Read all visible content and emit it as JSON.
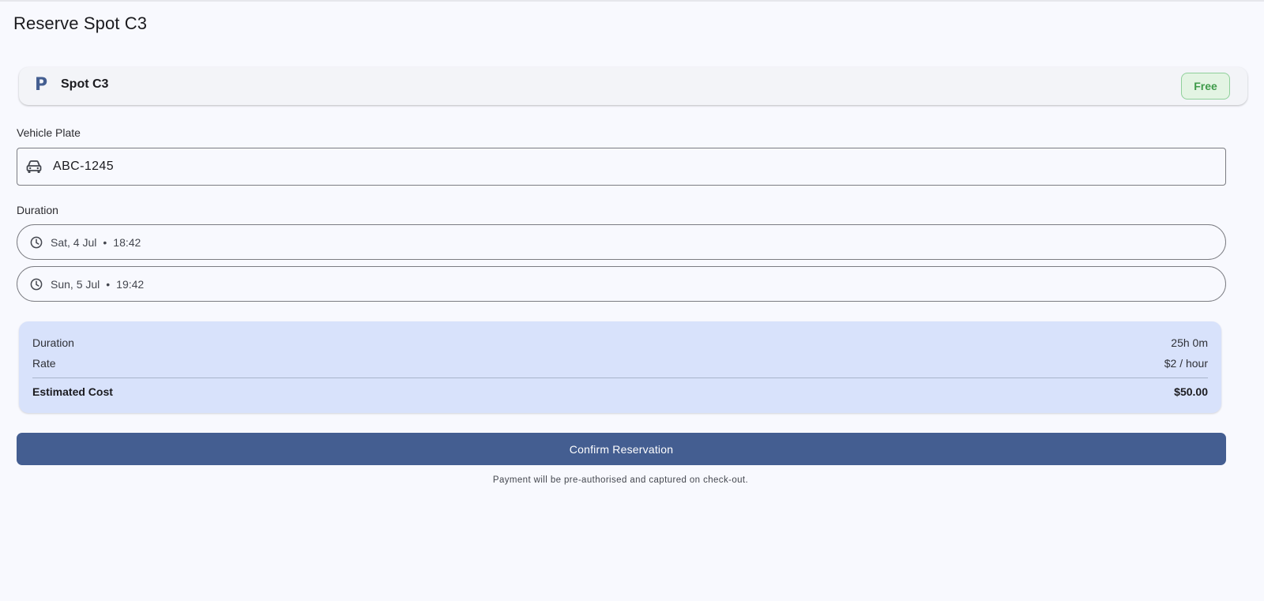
{
  "app_bar": {
    "title": "Reserve Spot C3"
  },
  "spot": {
    "icon_glyph": "P",
    "icon": "parking-icon",
    "name": "Spot C3",
    "status": "Free",
    "status_color": "#3f9b4a"
  },
  "vehicle": {
    "label": "Vehicle Plate",
    "icon": "car-icon",
    "value": "ABC-1245"
  },
  "duration": {
    "label": "Duration",
    "start": {
      "icon": "clock-icon",
      "date": "Sat, 4 Jul",
      "separator": "•",
      "time": "18:42"
    },
    "end": {
      "icon": "clock-icon",
      "date": "Sun, 5 Jul",
      "separator": "•",
      "time": "19:42"
    }
  },
  "summary": {
    "duration_label": "Duration",
    "duration_value": "25h 0m",
    "rate_label": "Rate",
    "rate_value": "$2 / hour",
    "cost_label": "Estimated Cost",
    "cost_value": "$50.00"
  },
  "confirm": {
    "label": "Confirm Reservation",
    "color": "#445e91"
  },
  "footnote": "Payment will be pre-authorised and captured on check-out."
}
